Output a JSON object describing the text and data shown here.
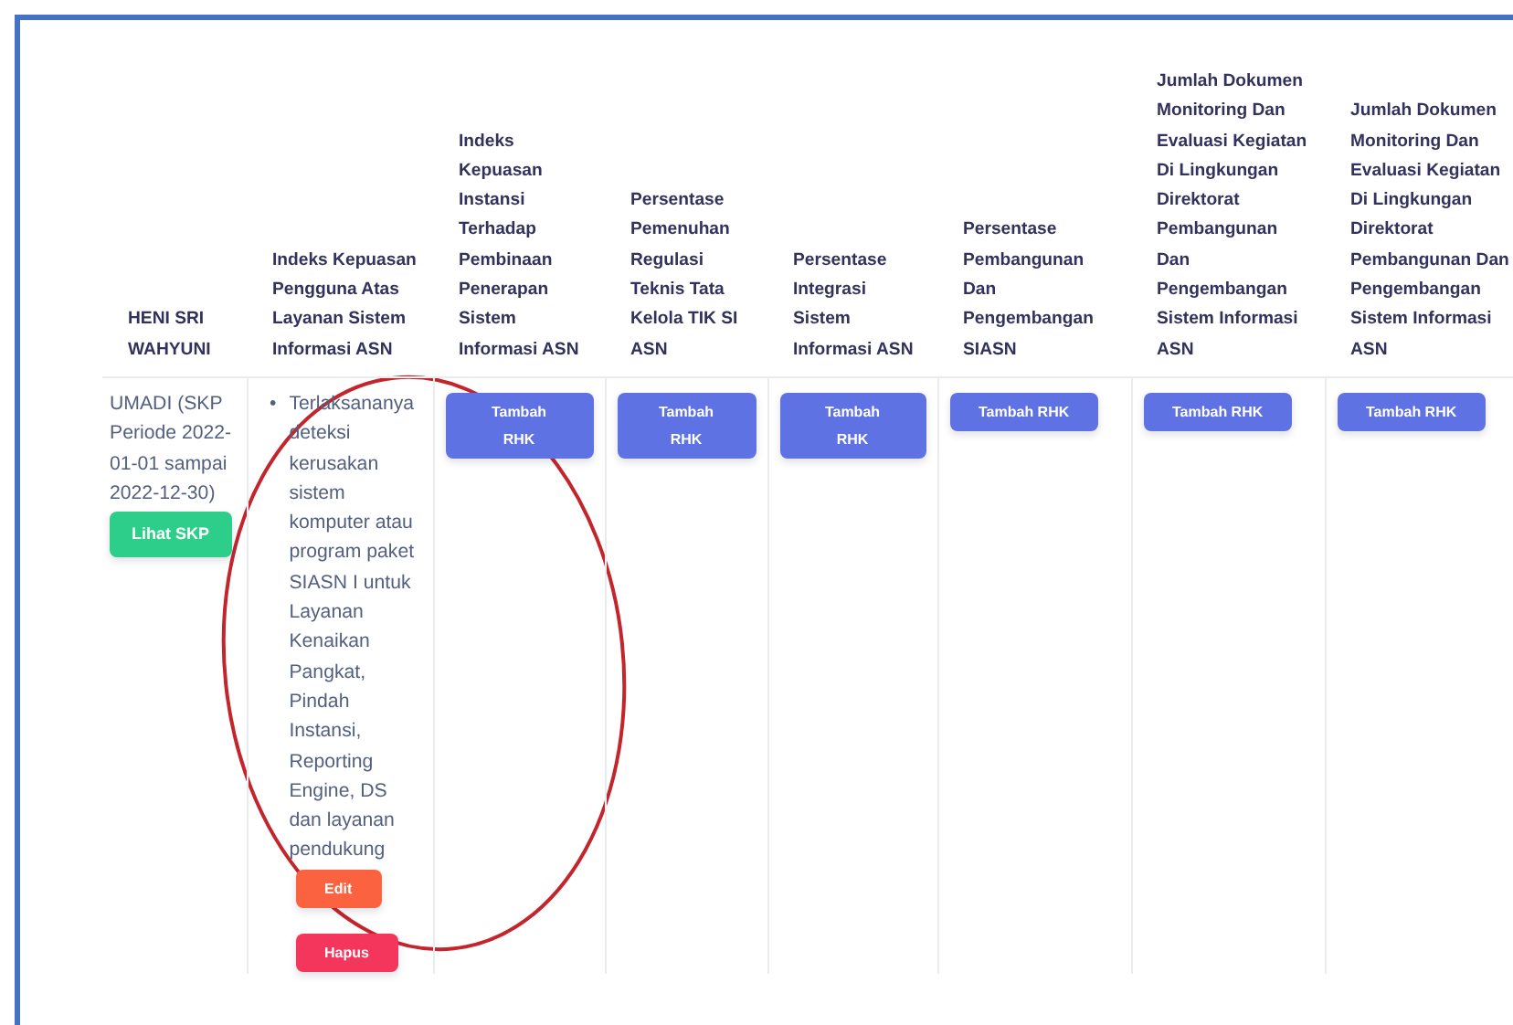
{
  "table": {
    "columns": [
      "HENI SRI WAHYUNI",
      "Indeks Kepuasan Pengguna Atas Layanan Sistem Informasi ASN",
      "Indeks Kepuasan Instansi Terhadap Pembinaan Penerapan Sistem Informasi ASN",
      "Persentase Pemenuhan Regulasi Teknis Tata Kelola TIK SI ASN",
      "Persentase Integrasi Sistem Informasi ASN",
      "Persentase Pembangunan Dan Pengembangan SIASN",
      "Jumlah Dokumen Monitoring Dan Evaluasi Kegiatan Di Lingkungan Direktorat Pembangunan Dan Pengembangan Sistem Informasi ASN",
      "Jumlah Dokumen Monitoring Dan Evaluasi Kegiatan Di Lingkungan Direktorat Pembangunan Dan Pengembangan Sistem Informasi ASN"
    ],
    "rows": [
      {
        "cells": [
          {
            "kind": "person",
            "text": "UMADI (SKP Periode 2022-01-01 sampai 2022-12-30)",
            "buttons": [
              {
                "label": "Lihat SKP",
                "kind": "view"
              }
            ]
          },
          {
            "kind": "list",
            "marker": "•",
            "items": [
              "Terlaksananya deteksi kerusakan sistem komputer atau program paket SIASN I untuk Layanan Kenaikan Pangkat, Pindah Instansi, Reporting Engine, DS dan layanan pendukung"
            ],
            "buttons": [
              {
                "label": "Edit",
                "kind": "edit"
              },
              {
                "label": "Hapus",
                "kind": "delete"
              }
            ]
          },
          {
            "kind": "action",
            "buttons": [
              {
                "label": "Tambah RHK",
                "kind": "add"
              }
            ]
          },
          {
            "kind": "action",
            "buttons": [
              {
                "label": "Tambah RHK",
                "kind": "add"
              }
            ]
          },
          {
            "kind": "action",
            "buttons": [
              {
                "label": "Tambah RHK",
                "kind": "add"
              }
            ]
          },
          {
            "kind": "action",
            "buttons": [
              {
                "label": "Tambah RHK",
                "kind": "add"
              }
            ]
          },
          {
            "kind": "action",
            "buttons": [
              {
                "label": "Tambah RHK",
                "kind": "add"
              }
            ]
          },
          {
            "kind": "action",
            "buttons": [
              {
                "label": "Tambah RHK",
                "kind": "add"
              }
            ]
          }
        ]
      }
    ]
  }
}
